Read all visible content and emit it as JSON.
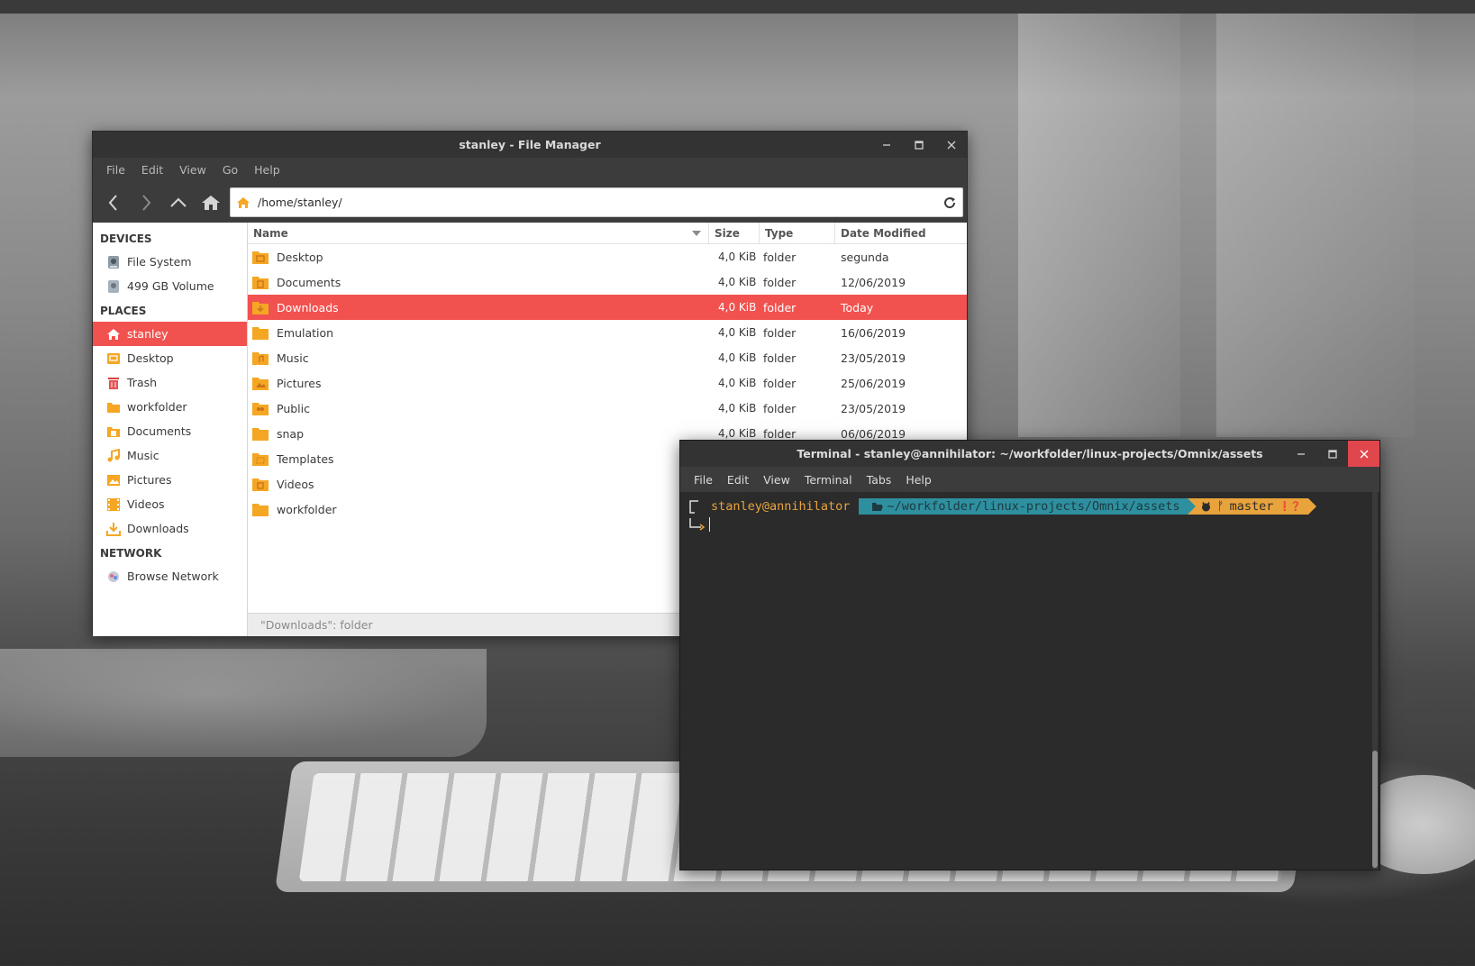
{
  "colors": {
    "accent": "#f2524f",
    "folder": "#f5a623",
    "titlebar": "#333333",
    "terminal_bg": "#2b2b2b",
    "prompt_user": "#e8a33d",
    "prompt_path_bg": "#2e8f9e",
    "close_button": "#e0474c"
  },
  "file_manager": {
    "title": "stanley - File Manager",
    "menu": [
      "File",
      "Edit",
      "View",
      "Go",
      "Help"
    ],
    "toolbar": {
      "back_icon": "chevron-left-icon",
      "forward_icon": "chevron-right-icon",
      "up_icon": "chevron-up-icon",
      "home_icon": "home-icon",
      "reload_icon": "reload-icon"
    },
    "path": "/home/stanley/",
    "sidebar": {
      "devices_header": "DEVICES",
      "devices": [
        {
          "label": "File System",
          "icon": "drive-icon"
        },
        {
          "label": "499 GB Volume",
          "icon": "drive-icon"
        }
      ],
      "places_header": "PLACES",
      "places": [
        {
          "label": "stanley",
          "icon": "home-icon",
          "active": true
        },
        {
          "label": "Desktop",
          "icon": "desktop-folder-icon"
        },
        {
          "label": "Trash",
          "icon": "trash-icon"
        },
        {
          "label": "workfolder",
          "icon": "folder-icon"
        },
        {
          "label": "Documents",
          "icon": "documents-icon"
        },
        {
          "label": "Music",
          "icon": "music-icon"
        },
        {
          "label": "Pictures",
          "icon": "pictures-icon"
        },
        {
          "label": "Videos",
          "icon": "videos-icon"
        },
        {
          "label": "Downloads",
          "icon": "downloads-icon"
        }
      ],
      "network_header": "NETWORK",
      "network": [
        {
          "label": "Browse Network",
          "icon": "network-icon"
        }
      ]
    },
    "columns": {
      "name": "Name",
      "size": "Size",
      "type": "Type",
      "date": "Date Modified"
    },
    "files": [
      {
        "name": "Desktop",
        "size": "4,0 KiB",
        "type": "folder",
        "date": "segunda",
        "icon": "desktop-folder-icon"
      },
      {
        "name": "Documents",
        "size": "4,0 KiB",
        "type": "folder",
        "date": "12/06/2019",
        "icon": "documents-folder-icon"
      },
      {
        "name": "Downloads",
        "size": "4,0 KiB",
        "type": "folder",
        "date": "Today",
        "icon": "downloads-folder-icon",
        "selected": true
      },
      {
        "name": "Emulation",
        "size": "4,0 KiB",
        "type": "folder",
        "date": "16/06/2019",
        "icon": "folder-icon"
      },
      {
        "name": "Music",
        "size": "4,0 KiB",
        "type": "folder",
        "date": "23/05/2019",
        "icon": "music-folder-icon"
      },
      {
        "name": "Pictures",
        "size": "4,0 KiB",
        "type": "folder",
        "date": "25/06/2019",
        "icon": "pictures-folder-icon"
      },
      {
        "name": "Public",
        "size": "4,0 KiB",
        "type": "folder",
        "date": "23/05/2019",
        "icon": "public-folder-icon"
      },
      {
        "name": "snap",
        "size": "4,0 KiB",
        "type": "folder",
        "date": "06/06/2019",
        "icon": "folder-icon"
      },
      {
        "name": "Templates",
        "size": "",
        "type": "",
        "date": "",
        "icon": "templates-folder-icon"
      },
      {
        "name": "Videos",
        "size": "",
        "type": "",
        "date": "",
        "icon": "videos-folder-icon"
      },
      {
        "name": "workfolder",
        "size": "",
        "type": "",
        "date": "",
        "icon": "folder-icon"
      }
    ],
    "status": "\"Downloads\": folder"
  },
  "terminal": {
    "title": "Terminal - stanley@annihilator: ~/workfolder/linux-projects/Omnix/assets",
    "menu": [
      "File",
      "Edit",
      "View",
      "Terminal",
      "Tabs",
      "Help"
    ],
    "prompt": {
      "user": "stanley@annihilator",
      "path": "~/workfolder/linux-projects/Omnix/assets",
      "branch": "master",
      "branch_glyph": "ᚠ",
      "status_glyphs": "❗❓"
    }
  }
}
